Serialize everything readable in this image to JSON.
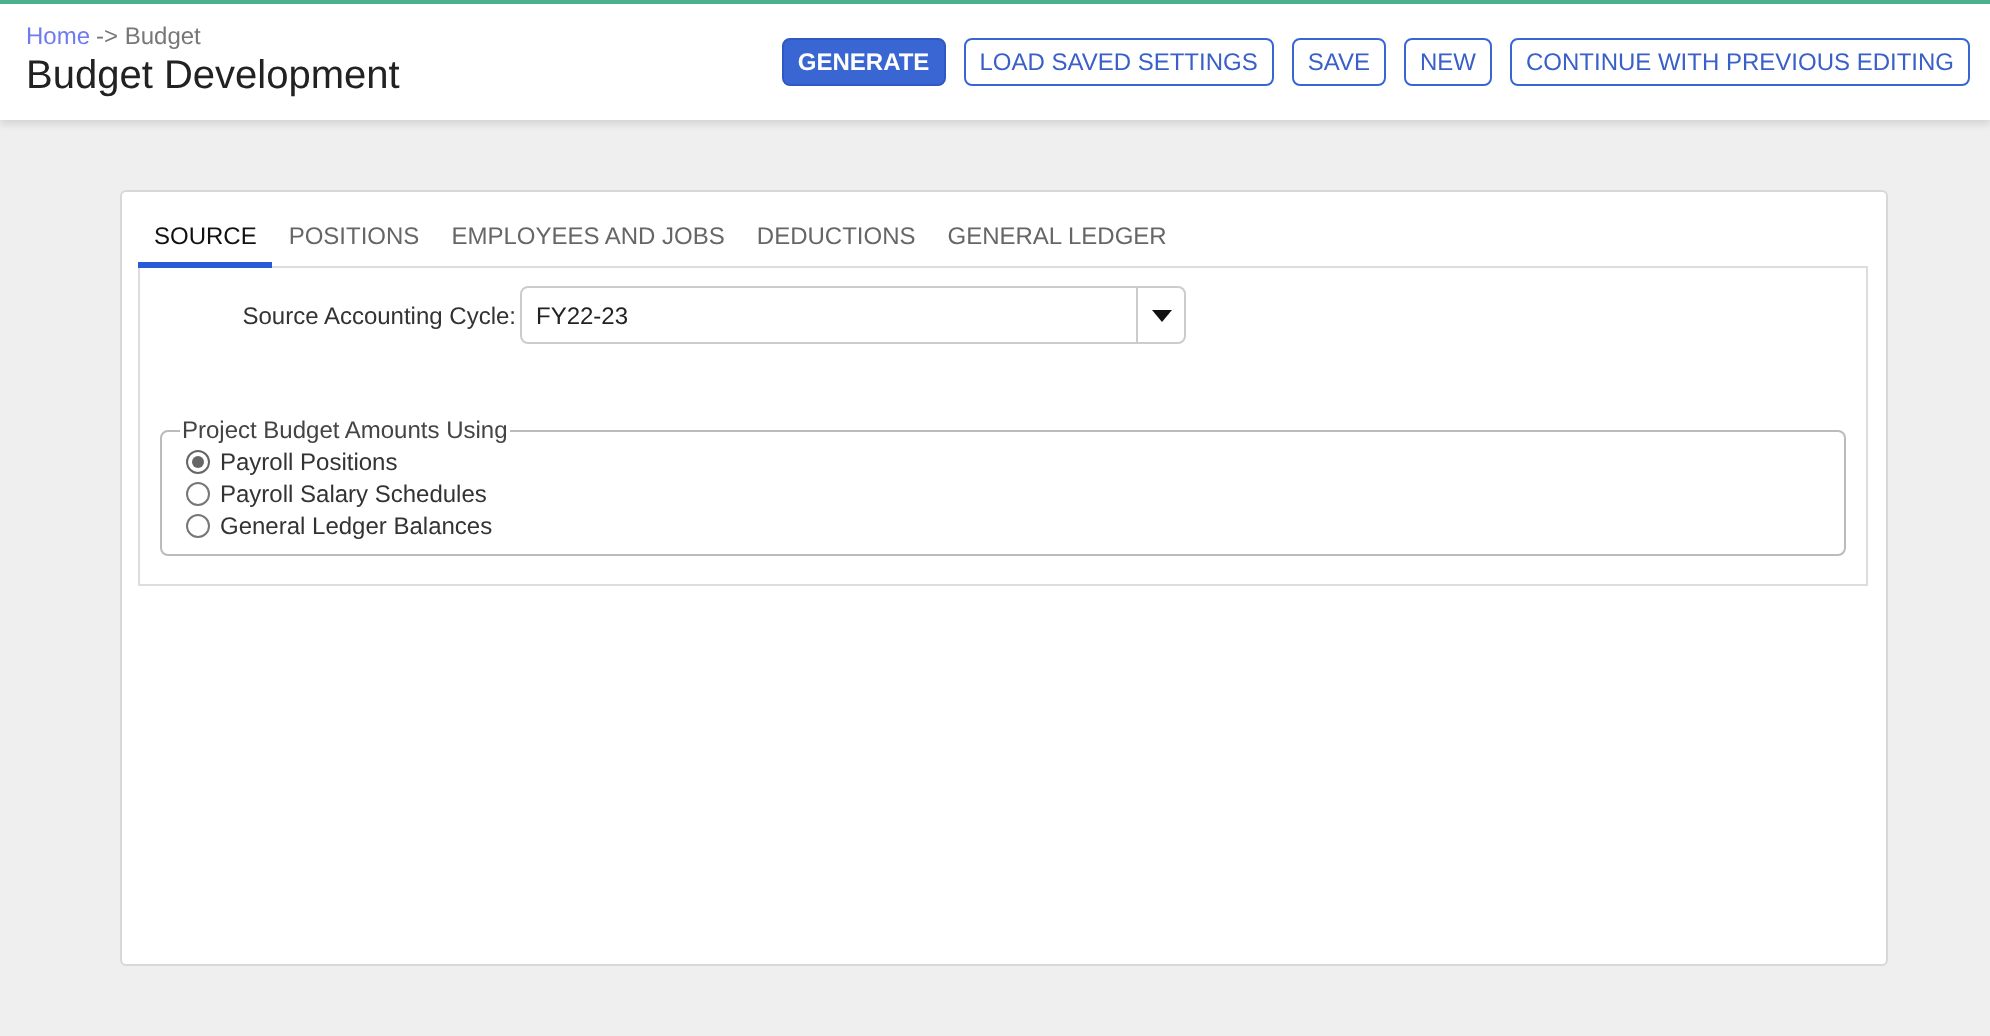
{
  "breadcrumb": {
    "link": "Home",
    "rest": "-> Budget"
  },
  "title": "Budget Development",
  "buttons": [
    {
      "label": "GENERATE",
      "kind": "primary"
    },
    {
      "label": "LOAD SAVED SETTINGS",
      "kind": "outline"
    },
    {
      "label": "SAVE",
      "kind": "outline"
    },
    {
      "label": "NEW",
      "kind": "outline"
    },
    {
      "label": "CONTINUE WITH PREVIOUS EDITING",
      "kind": "outline"
    }
  ],
  "tabs": [
    {
      "label": "SOURCE",
      "selected": true
    },
    {
      "label": "POSITIONS",
      "selected": false
    },
    {
      "label": "EMPLOYEES AND JOBS",
      "selected": false
    },
    {
      "label": "DEDUCTIONS",
      "selected": false
    },
    {
      "label": "GENERAL LEDGER",
      "selected": false
    }
  ],
  "source_cycle": {
    "label": "Source Accounting Cycle:",
    "value": "FY22-23"
  },
  "project_group": {
    "legend": "Project Budget Amounts Using",
    "options": [
      {
        "label": "Payroll Positions",
        "selected": true
      },
      {
        "label": "Payroll Salary Schedules",
        "selected": false
      },
      {
        "label": "General Ledger Balances",
        "selected": false
      }
    ]
  }
}
